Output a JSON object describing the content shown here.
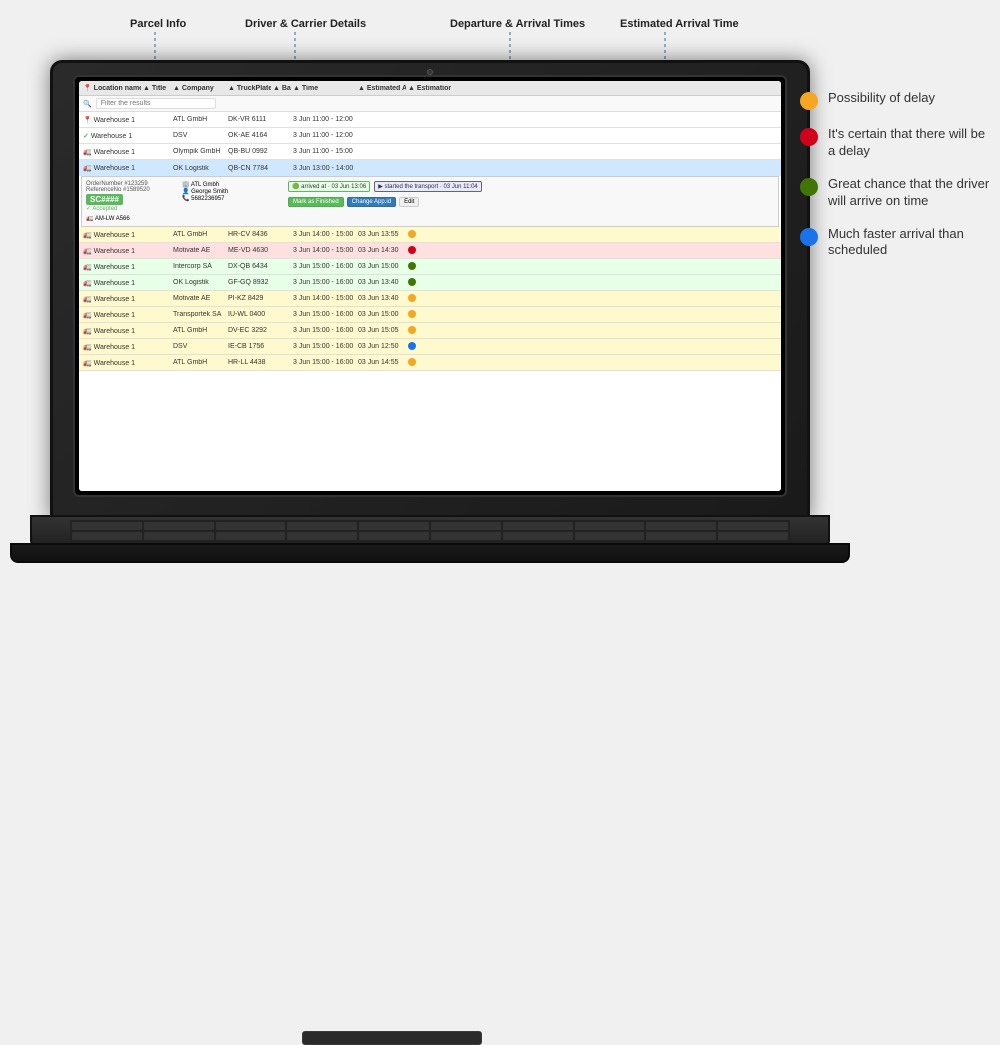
{
  "annotations": {
    "parcel_info": "Parcel Info",
    "driver_carrier": "Driver & Carrier Details",
    "departure_arrival": "Departure & Arrival Times",
    "estimated_arrival": "Estimated Arrival Time"
  },
  "legend": {
    "items": [
      {
        "id": "yellow",
        "color": "#f5a623",
        "text": "Possibility of delay"
      },
      {
        "id": "red",
        "color": "#d0021b",
        "text": "It's certain that there will be a delay"
      },
      {
        "id": "green",
        "color": "#417505",
        "text": "Great chance that the driver will arrive on time"
      },
      {
        "id": "blue",
        "color": "#1a73e8",
        "text": "Much faster arrival than scheduled"
      }
    ]
  },
  "table": {
    "headers": [
      "Location name",
      "Title",
      "Company",
      "TruckPlate",
      "Bay",
      "Time",
      "Estimated Arrival",
      "Estimation status"
    ],
    "search_placeholder": "Filter the results",
    "rows": [
      {
        "id": 1,
        "location": "Warehouse 1",
        "title": "",
        "company": "ATL GmbH",
        "truck": "DK-VR 6111",
        "bay": "",
        "time": "3 Jun 11:00 - 12:00",
        "estimated": "",
        "status": "",
        "color": "white",
        "icon": "location"
      },
      {
        "id": 2,
        "location": "Warehouse 1",
        "title": "",
        "company": "DSV",
        "truck": "OK-AE 4164",
        "bay": "",
        "time": "3 Jun 11:00 - 12:00",
        "estimated": "",
        "status": "",
        "color": "white",
        "icon": "check"
      },
      {
        "id": 3,
        "location": "Warehouse 1",
        "title": "",
        "company": "Olympik GmbH",
        "truck": "QB-BU 0992",
        "bay": "",
        "time": "3 Jun 11:00 - 15:00",
        "estimated": "",
        "status": "",
        "color": "white",
        "icon": "truck"
      },
      {
        "id": 4,
        "location": "Warehouse 1",
        "title": "",
        "company": "OK Logistik",
        "truck": "QB-CN 7784",
        "bay": "",
        "time": "3 Jun 13:00 - 14:00",
        "estimated": "",
        "status": "",
        "color": "white",
        "icon": "truck"
      },
      {
        "id": "expanded",
        "order": "OrderNumber #123259",
        "reference": "ReferenceNo #1589520",
        "sc": "SC####",
        "accepted": "✓ Accepted",
        "company_exp": "ATL Gmbh",
        "driver": "George Smith",
        "phone": "5682236957",
        "truck_img": "AM-LW A566",
        "arrived": "arrived at · 03 Jun 13:06",
        "transport": "started the transport · 03 Jun 11:04",
        "markAsFinished": "Mark as Finished",
        "changeApp": "Change App.id",
        "edit": "Edit"
      },
      {
        "id": 5,
        "location": "Warehouse 1",
        "title": "",
        "company": "ATL GmbH",
        "truck": "HR-CV 8436",
        "bay": "",
        "time": "3 Jun 14:00 - 15:00",
        "estimated": "03 Jun 13:55",
        "status": "yellow",
        "color": "yellow"
      },
      {
        "id": 6,
        "location": "Warehouse 1",
        "title": "",
        "company": "Motivate AE",
        "truck": "ME-VD 4630",
        "bay": "",
        "time": "3 Jun 14:00 - 15:00",
        "estimated": "03 Jun 14:30",
        "status": "red",
        "color": "red-light"
      },
      {
        "id": 7,
        "location": "Warehouse 1",
        "title": "",
        "company": "Intercorp SA",
        "truck": "DX-QB 6434",
        "bay": "",
        "time": "3 Jun 15:00 - 16:00",
        "estimated": "03 Jun 15:00",
        "status": "green",
        "color": "green-light"
      },
      {
        "id": 8,
        "location": "Warehouse 1",
        "title": "",
        "company": "OK Logistik",
        "truck": "GF-GQ 8932",
        "bay": "",
        "time": "3 Jun 15:00 - 16:00",
        "estimated": "03 Jun 13:40",
        "status": "green",
        "color": "green-light"
      },
      {
        "id": 9,
        "location": "Warehouse 1",
        "title": "",
        "company": "Motivate AE",
        "truck": "PI-KZ 8429",
        "bay": "",
        "time": "3 Jun 14:00 - 15:00",
        "estimated": "03 Jun 13:40",
        "status": "yellow",
        "color": "yellow"
      },
      {
        "id": 10,
        "location": "Warehouse 1",
        "title": "",
        "company": "Transportek SA",
        "truck": "IU-WL 0400",
        "bay": "",
        "time": "3 Jun 15:00 - 16:00",
        "estimated": "03 Jun 15:00",
        "status": "yellow",
        "color": "yellow"
      },
      {
        "id": 11,
        "location": "Warehouse 1",
        "title": "",
        "company": "ATL GmbH",
        "truck": "DV-EC 3292",
        "bay": "",
        "time": "3 Jun 15:00 - 16:00",
        "estimated": "03 Jun 15:05",
        "status": "yellow",
        "color": "yellow"
      },
      {
        "id": 12,
        "location": "Warehouse 1",
        "title": "",
        "company": "DSV",
        "truck": "IE-CB 1756",
        "bay": "",
        "time": "3 Jun 15:00 - 16:00",
        "estimated": "03 Jun 12:50",
        "status": "blue",
        "color": "yellow"
      },
      {
        "id": 13,
        "location": "Warehouse 1",
        "title": "",
        "company": "ATL GmbH",
        "truck": "HR-LL 4438",
        "bay": "",
        "time": "3 Jun 15:00 - 16:00",
        "estimated": "03 Jun 14:55",
        "status": "yellow",
        "color": "yellow"
      }
    ]
  }
}
